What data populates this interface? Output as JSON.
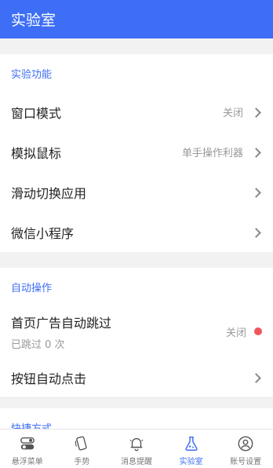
{
  "appbar": {
    "title": "实验室"
  },
  "experimental": {
    "title": "实验功能",
    "items": [
      {
        "label": "窗口模式",
        "value": "关闭"
      },
      {
        "label": "模拟鼠标",
        "value": "单手操作利器"
      },
      {
        "label": "滑动切换应用",
        "value": ""
      },
      {
        "label": "微信小程序",
        "value": ""
      }
    ]
  },
  "auto": {
    "title": "自动操作",
    "skip_ads": {
      "label": "首页广告自动跳过",
      "sub": "已跳过 0 次",
      "value": "关闭",
      "dot_color": "#f0575a"
    },
    "auto_click": {
      "label": "按钮自动点击"
    }
  },
  "shortcuts": {
    "title": "快捷方式"
  },
  "bottom_nav": [
    {
      "label": "悬浮菜单",
      "icon": "toggle-icon"
    },
    {
      "label": "手势",
      "icon": "phone-gesture-icon"
    },
    {
      "label": "消息提醒",
      "icon": "bell-icon"
    },
    {
      "label": "实验室",
      "icon": "flask-icon",
      "active": true
    },
    {
      "label": "账号设置",
      "icon": "user-icon"
    }
  ],
  "colors": {
    "accent": "#3d6ef5",
    "status_off": "#f0575a",
    "background": "#f2f2f2"
  }
}
